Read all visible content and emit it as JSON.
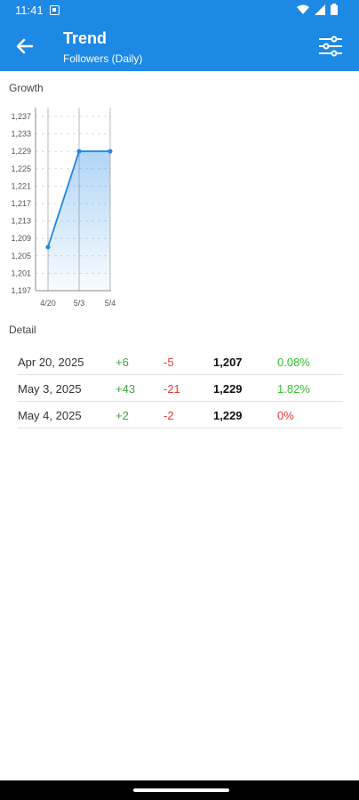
{
  "status": {
    "time": "11:41"
  },
  "header": {
    "title": "Trend",
    "subtitle": "Followers (Daily)"
  },
  "growth": {
    "label": "Growth"
  },
  "chart_data": {
    "type": "area",
    "x": [
      "4/20",
      "5/3",
      "5/4"
    ],
    "values": [
      1207,
      1229,
      1229
    ],
    "yticks": [
      1197,
      1201,
      1205,
      1209,
      1213,
      1217,
      1221,
      1225,
      1229,
      1233,
      1237
    ],
    "ylim": [
      1197,
      1237
    ],
    "color": "#1e88e5",
    "grid": true
  },
  "detail": {
    "label": "Detail",
    "rows": [
      {
        "date": "Apr 20, 2025",
        "plus": "+6",
        "minus": "-5",
        "total": "1,207",
        "pct": "0.08%"
      },
      {
        "date": "May 3, 2025",
        "plus": "+43",
        "minus": "-21",
        "total": "1,229",
        "pct": "1.82%"
      },
      {
        "date": "May 4, 2025",
        "plus": "+2",
        "minus": "-2",
        "total": "1,229",
        "pct": "0%"
      }
    ]
  },
  "colors": {
    "primary": "#1e88e5",
    "positive": "#43a047",
    "negative": "#e53935"
  }
}
